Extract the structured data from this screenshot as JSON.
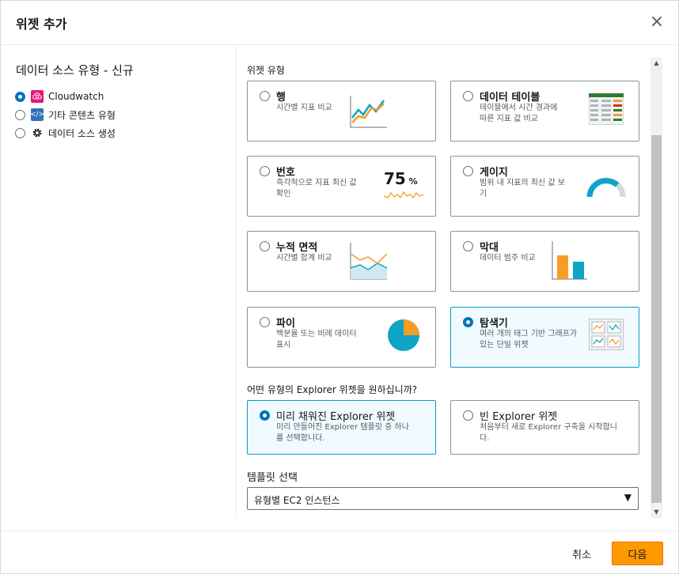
{
  "dialog": {
    "title": "위젯 추가",
    "close_icon": "×"
  },
  "data_source": {
    "title": "데이터 소스 유형 - 신규",
    "options": [
      {
        "label": "Cloudwatch",
        "selected": true,
        "icon": "cloudwatch-icon",
        "icon_color": "#e7157b"
      },
      {
        "label": "기타 콘텐츠 유형",
        "selected": false,
        "icon": "code-icon",
        "icon_color": "#2e73b8"
      },
      {
        "label": "데이터 소스 생성",
        "selected": false,
        "icon": "gear-icon",
        "icon_color": "#16191f"
      }
    ]
  },
  "widget_type": {
    "label": "위젯 유형",
    "cards": [
      {
        "title": "행",
        "desc": "시간별 지표 비교",
        "selected": false,
        "icon": "line-chart-icon"
      },
      {
        "title": "데이터 테이블",
        "desc": "테이블에서 시간 경과에 따른 지표 값 비교",
        "selected": false,
        "icon": "table-icon"
      },
      {
        "title": "번호",
        "desc": "즉각적으로 지표 최신 값 확인",
        "selected": false,
        "icon": "number-icon",
        "number_text": "75",
        "number_unit": "%"
      },
      {
        "title": "게이지",
        "desc": "범위 내 지표의 최신 값 보기",
        "selected": false,
        "icon": "gauge-icon"
      },
      {
        "title": "누적 면적",
        "desc": "시간별 합계 비교",
        "selected": false,
        "icon": "stacked-area-icon"
      },
      {
        "title": "막대",
        "desc": "데이터 범주 비교",
        "selected": false,
        "icon": "bar-chart-icon"
      },
      {
        "title": "파이",
        "desc": "백분율 또는 비례 데이터 표시",
        "selected": false,
        "icon": "pie-chart-icon"
      },
      {
        "title": "탐색기",
        "desc": "여러 개의 태그 기반 그래프가 있는 단일 위젯",
        "selected": true,
        "icon": "explorer-icon"
      }
    ]
  },
  "explorer": {
    "question": "어떤 유형의 Explorer 위젯을 원하십니까?",
    "options": [
      {
        "title": "미리 채워진 Explorer 위젯",
        "desc": "미리 만들어진 Explorer 템플릿 중 하나를 선택합니다.",
        "selected": true
      },
      {
        "title": "빈 Explorer 위젯",
        "desc": "처음부터 새로 Explorer 구축을 시작합니다.",
        "selected": false
      }
    ]
  },
  "template": {
    "label": "템플릿 선택",
    "value": "유형별 EC2 인스턴스",
    "caret": "▼"
  },
  "footer": {
    "cancel_label": "취소",
    "next_label": "다음"
  },
  "colors": {
    "accent": "#0073bb",
    "primary_button": "#ff9900",
    "selected_border": "#00a1c9",
    "selected_bg": "#f1faff",
    "chart_orange": "#f89c24",
    "chart_teal": "#0ea5c6"
  }
}
